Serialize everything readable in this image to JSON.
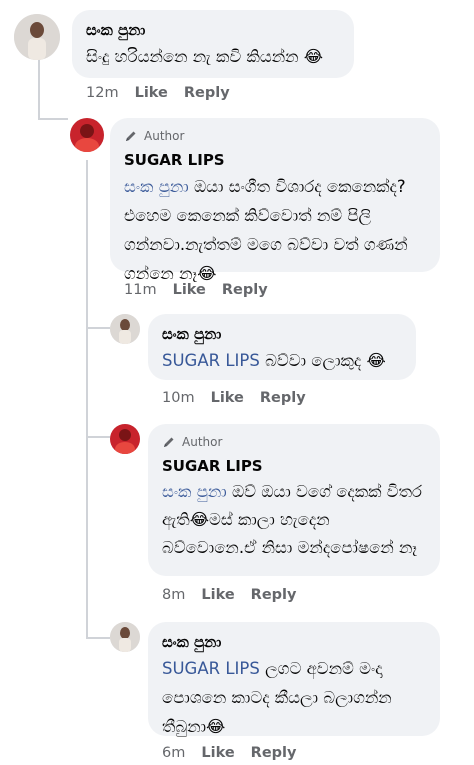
{
  "comments": [
    {
      "name": "සංක පුනා",
      "mention": "",
      "text": "සිංදු හරියන්නෙ නැ කවි කියන්න 😂",
      "time": "12m",
      "is_author": false
    },
    {
      "name": "SUGAR LIPS",
      "mention": "සංක පුනා",
      "text": " ඔයා සංගීත විශාරද කෙනෙක්ද?එහෙම කෙනෙක් කිව්වොත් නම් පිලි ගන්නවා.නැත්තම් මගෙ බව්වා වත් ගණන් ගන්නෙ නෑ😂",
      "time": "11m",
      "is_author": true
    },
    {
      "name": "සංක පුනා",
      "mention": "SUGAR LIPS",
      "text": " බව්වා ලොකුද 😂",
      "time": "10m",
      "is_author": false
    },
    {
      "name": "SUGAR LIPS",
      "mention": "සංක පුනා",
      "text": " ඔව් ඔයා වගේ දෙකක් විතර ඇති😂මස් කාලා හැදෙන බව්වොනෙ.ඒ නිසා මන්දපෝෂනේ නෑ",
      "time": "8m",
      "is_author": true
    },
    {
      "name": "සංක පුනා",
      "mention": "SUGAR LIPS",
      "text": " ලගට අවනම් මංදා පොශනෙ කාටද කීයලා බලාගන්න තීබුනා😂",
      "time": "6m",
      "is_author": false
    }
  ],
  "labels": {
    "author": "Author",
    "like": "Like",
    "reply": "Reply"
  },
  "colors": {
    "mention": "#385898",
    "bubble": "#f0f2f5",
    "meta": "#65676b"
  }
}
